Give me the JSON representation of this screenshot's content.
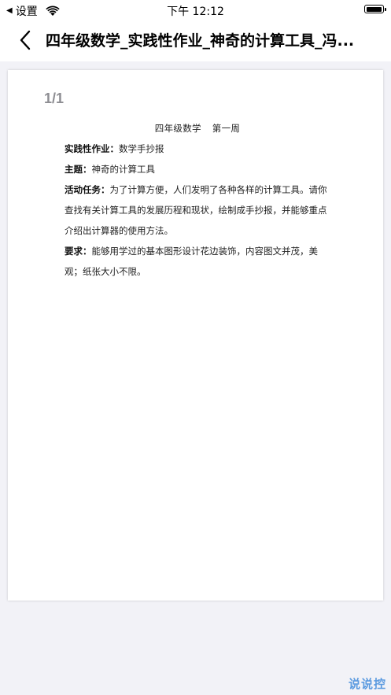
{
  "status_bar": {
    "carrier_back": "设置",
    "time": "下午 12:12",
    "battery_level": 0.95
  },
  "nav": {
    "title": "四年级数学_实践性作业_神奇的计算工具_冯..."
  },
  "viewer": {
    "page_indicator": "1/1"
  },
  "document": {
    "header_part1": "四年级数学",
    "header_part2": "第一周",
    "paragraphs": [
      {
        "label": "实践性作业：",
        "text": "数学手抄报"
      },
      {
        "label": "主题：",
        "text": "神奇的计算工具"
      },
      {
        "label": "活动任务：",
        "text": "为了计算方便，人们发明了各种各样的计算工具。请你查找有关计算工具的发展历程和现状，绘制成手抄报，并能够重点介绍出计算器的使用方法。"
      },
      {
        "label": "要求：",
        "text": "能够用学过的基本图形设计花边装饰，内容图文并茂，美观；纸张大小不限。"
      }
    ]
  },
  "watermark": "说说控",
  "colors": {
    "background": "#f2f2f7",
    "page_indicator": "#8e8e93",
    "watermark": "#5c9be0"
  }
}
